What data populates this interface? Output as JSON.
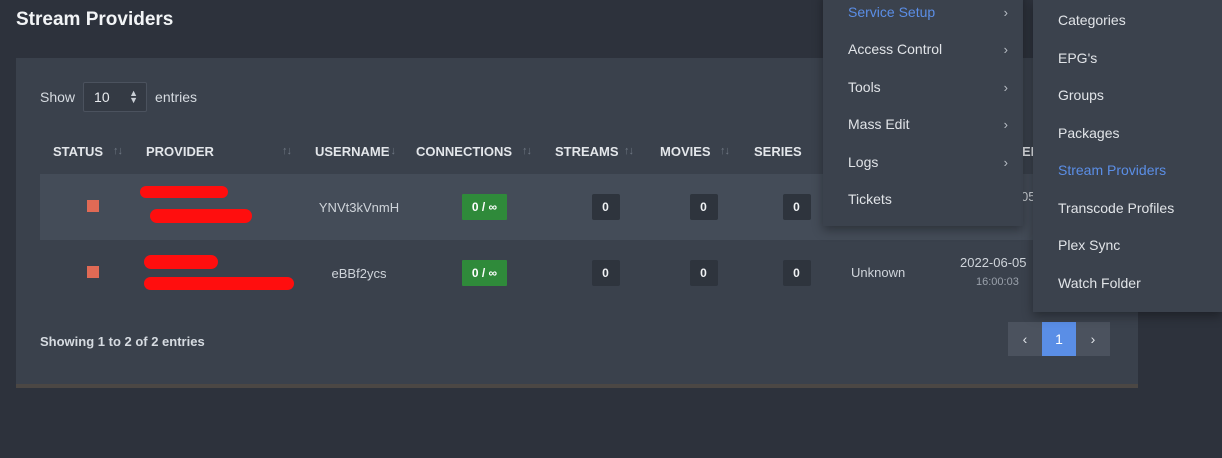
{
  "page": {
    "title": "Stream Providers"
  },
  "length": {
    "show_label": "Show",
    "value": "10",
    "entries_label": "entries"
  },
  "table": {
    "headers": [
      "STATUS",
      "PROVIDER",
      "USERNAME",
      "CONNECTIONS",
      "STREAMS",
      "MOVIES",
      "SERIES"
    ],
    "rows": [
      {
        "username": "YNVt3kVnmH",
        "connections": "0 / ∞",
        "streams": "0",
        "movies": "0",
        "series": "0"
      },
      {
        "username": "eBBf2ycs",
        "connections": "0 / ∞",
        "streams": "0",
        "movies": "0",
        "series": "0",
        "status_text": "Unknown",
        "date": "2022-06-05",
        "time": "16:00:03"
      }
    ],
    "clipped_header": "EI",
    "clipped_row1": "05"
  },
  "footer": {
    "showing": "Showing 1 to 2 of 2 entries",
    "prev": "‹",
    "page": "1",
    "next": "›"
  },
  "menu": {
    "main": [
      {
        "label": "Service Setup",
        "arrow": "›"
      },
      {
        "label": "Access Control",
        "arrow": "›"
      },
      {
        "label": "Tools",
        "arrow": "›"
      },
      {
        "label": "Mass Edit",
        "arrow": "›"
      },
      {
        "label": "Logs",
        "arrow": "›"
      },
      {
        "label": "Tickets",
        "arrow": ""
      }
    ],
    "sub": [
      "Categories",
      "EPG's",
      "Groups",
      "Packages",
      "Stream Providers",
      "Transcode Profiles",
      "Plex Sync",
      "Watch Folder"
    ]
  },
  "colors": {
    "accent": "#5b8ee6",
    "status": "#e06a55",
    "connections": "#2f8a3a",
    "redaction": "#ff0e0e"
  }
}
